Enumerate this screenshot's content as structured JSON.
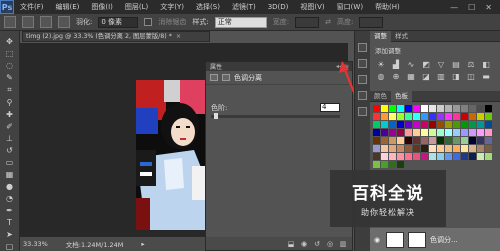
{
  "app": {
    "logo": "Ps",
    "menu": [
      "文件(F)",
      "编辑(E)",
      "图像(I)",
      "图层(L)",
      "文字(Y)",
      "选择(S)",
      "滤镜(T)",
      "3D(D)",
      "视图(V)",
      "窗口(W)",
      "帮助(H)"
    ],
    "window_controls": [
      "—",
      "☐",
      "✕"
    ]
  },
  "options": {
    "feather_label": "羽化:",
    "feather_value": "0 像素",
    "antialias_label": "消除锯齿",
    "style_label": "样式:",
    "style_value": "正常",
    "width_label": "宽度:",
    "height_label": "高度:"
  },
  "document": {
    "tab_title": "timg (2).jpg @ 33.3% (色调分离 2, 图层蒙版/8) *",
    "close_icon": "×",
    "zoom": "33.33%",
    "doc_info": "文档:1.24M/1.24M"
  },
  "properties": {
    "panel_title": "属性",
    "adjustment_title": "色调分离",
    "levels_label": "色阶:",
    "levels_value": "4",
    "level_fraction": 0.02
  },
  "right_panel": {
    "adjust_tabs": [
      "调整",
      "样式"
    ],
    "adjust_heading": "添加调整",
    "color_tabs": [
      "颜色",
      "色板"
    ],
    "layer_name": "色调分..."
  },
  "watermark": {
    "main": "百科全说",
    "sub": "助你轻松解决"
  },
  "colors": {
    "accent_arrow": "#e63434",
    "swatches": [
      "#ff0000",
      "#ffff00",
      "#00ff00",
      "#00ffff",
      "#0000ff",
      "#ff00ff",
      "#ffffff",
      "#e6e6e6",
      "#cccccc",
      "#b3b3b3",
      "#999999",
      "#808080",
      "#666666",
      "#4d4d4d",
      "#000000",
      "#ff3333",
      "#ff9933",
      "#ffff66",
      "#99ff33",
      "#33ff99",
      "#33ffff",
      "#3399ff",
      "#3333ff",
      "#9933ff",
      "#ff33ff",
      "#ff3399",
      "#cc0000",
      "#cc6600",
      "#cccc00",
      "#66cc00",
      "#00cc66",
      "#00cccc",
      "#0066cc",
      "#0000cc",
      "#6600cc",
      "#cc00cc",
      "#cc0066",
      "#990000",
      "#994c00",
      "#999900",
      "#4c9900",
      "#009900",
      "#00994c",
      "#009999",
      "#004c99",
      "#000099",
      "#4c0099",
      "#990099",
      "#99004c",
      "#ff9999",
      "#ffcc99",
      "#ffff99",
      "#ccff99",
      "#99ffcc",
      "#99ffff",
      "#99ccff",
      "#9999ff",
      "#cc99ff",
      "#ff99ff",
      "#ff99cc",
      "#663300",
      "#996633",
      "#cc9966",
      "#ffcc99",
      "#330000",
      "#663333",
      "#996666",
      "#cc9999",
      "#003300",
      "#336633",
      "#669966",
      "#99cc99",
      "#000033",
      "#333366",
      "#666699",
      "#9999cc",
      "#f4c7a1",
      "#e8a77a",
      "#c68a5e",
      "#8d5b3a",
      "#5c3a22",
      "#2e1c10",
      "#ffe0bd",
      "#ffcd94",
      "#eac086",
      "#ffad60",
      "#ffe39f",
      "#d9b48f",
      "#a88465",
      "#7a5c45",
      "#4b3527",
      "#ffd1dc",
      "#ffb6c1",
      "#ff91a4",
      "#ff6f91",
      "#e75480",
      "#c71585",
      "#b0e0e6",
      "#87ceeb",
      "#6495ed",
      "#4169e1",
      "#1e3a8a",
      "#0b1e4d",
      "#cde8b0",
      "#a3d977",
      "#7cc242",
      "#4a9e2a",
      "#2f6e1a",
      "#1a3f0f"
    ]
  }
}
